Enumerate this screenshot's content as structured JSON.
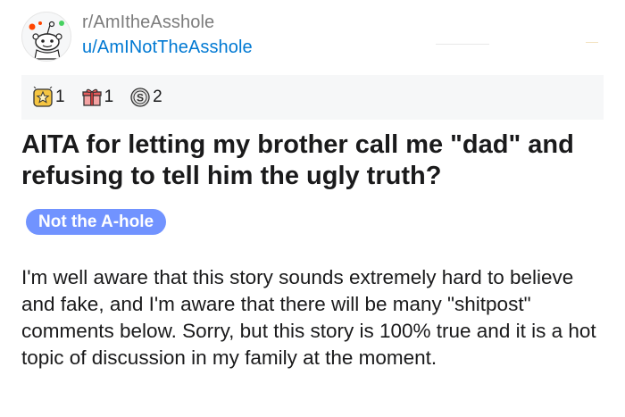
{
  "post": {
    "subreddit": "r/AmItheAsshole",
    "author": "u/AmINotTheAsshole",
    "awards": [
      {
        "icon": "star-award-icon",
        "count": "1"
      },
      {
        "icon": "gift-award-icon",
        "count": "1"
      },
      {
        "icon": "silver-coin-icon",
        "count": "2"
      }
    ],
    "title": "AITA for letting my brother call me \"dad\" and refusing to tell him the ugly truth?",
    "flair": "Not the A-hole",
    "body": "I'm well aware that this story sounds extremely hard to believe and fake, and I'm aware that there will be many \"shitpost\" comments below. Sorry, but this story is 100% true and it is a hot topic of discussion in my family at the moment."
  },
  "colors": {
    "link": "#0079d3",
    "muted": "#7c7c7c",
    "flair_bg": "#7193ff",
    "awards_bg": "#f6f7f8"
  }
}
